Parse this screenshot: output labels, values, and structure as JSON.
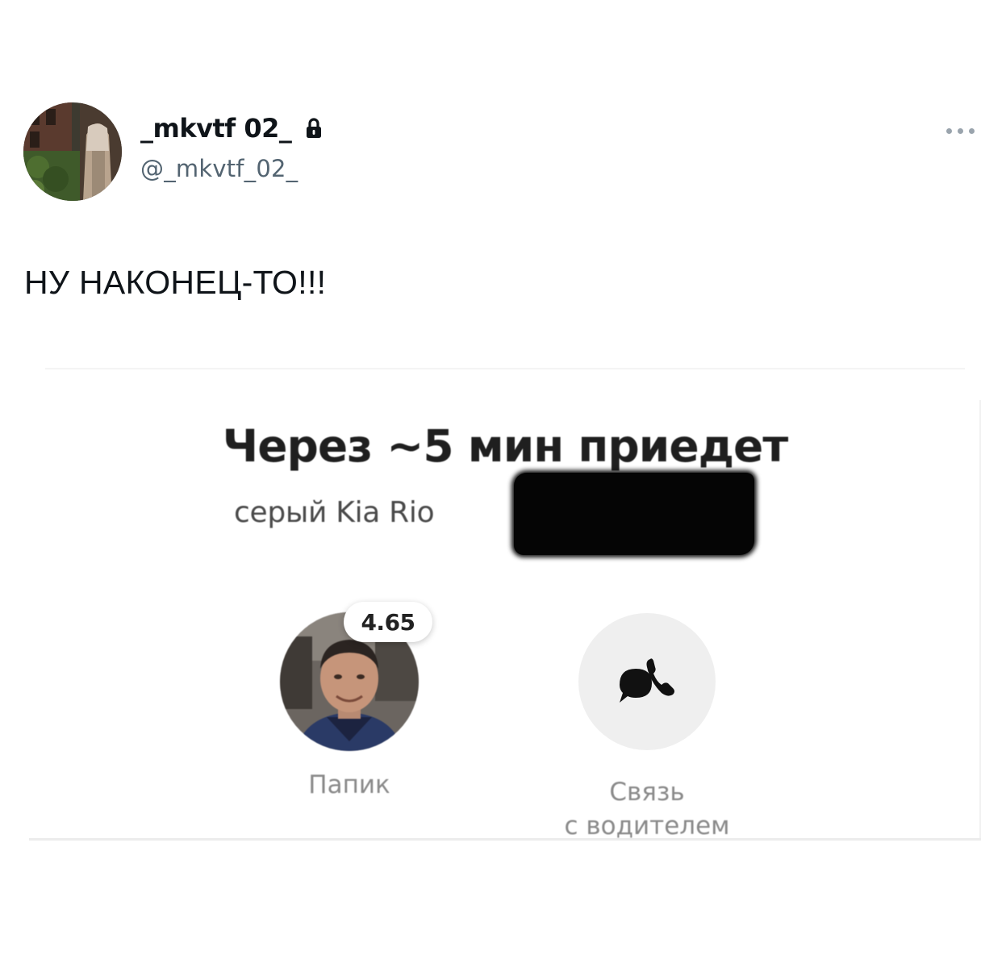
{
  "tweet": {
    "display_name": "_mkvtf 02_",
    "handle": "@_mkvtf_02_",
    "text": "НУ НАКОНЕЦ-ТО!!!",
    "icons": {
      "lock": "lock-icon",
      "more": "more-options-icon"
    }
  },
  "screenshot": {
    "eta_title": "Через ~5 мин приедет",
    "car_description": "серый Kia Rio",
    "driver": {
      "rating": "4.65",
      "name": "Папик"
    },
    "contact": {
      "label_line1": "Связь",
      "label_line2": "с водителем",
      "icon": "chat-phone-icon"
    }
  },
  "colors": {
    "text_primary": "#0f1419",
    "text_secondary": "#536471",
    "muted_label": "#8a8a8a",
    "contact_bg": "#efefef",
    "redaction": "#050505"
  }
}
